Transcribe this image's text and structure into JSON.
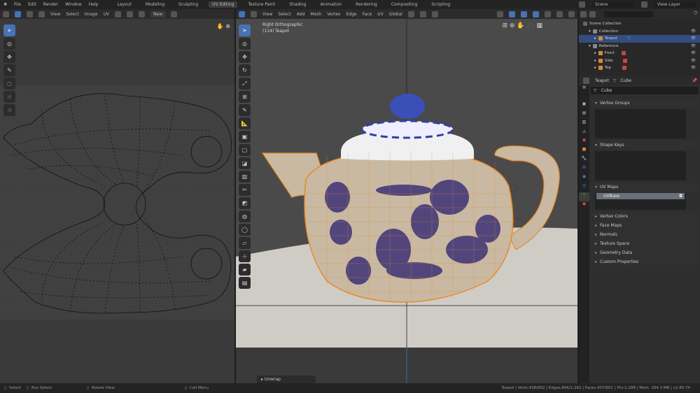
{
  "menu": [
    "File",
    "Edit",
    "Render",
    "Window",
    "Help"
  ],
  "workspaces": [
    "Layout",
    "Modeling",
    "Sculpting",
    "UV Editing",
    "Texture Paint",
    "Shading",
    "Animation",
    "Rendering",
    "Compositing",
    "Scripting"
  ],
  "active_workspace": "UV Editing",
  "scene": "Scene",
  "view_layer": "View Layer",
  "uv_header": {
    "menus": [
      "View",
      "Select",
      "Image",
      "UV"
    ],
    "new_label": "New"
  },
  "vp_header": {
    "menus": [
      "View",
      "Select",
      "Add",
      "Mesh",
      "Vertex",
      "Edge",
      "Face",
      "UV"
    ],
    "orientation": "Global"
  },
  "viewport": {
    "view_name": "Right Orthographic",
    "object_label": "(114) Teapot",
    "operator_panel": "Unwrap"
  },
  "outliner": {
    "search_placeholder": "",
    "rows": [
      {
        "label": "Scene Collection",
        "level": 0
      },
      {
        "label": "Collection",
        "level": 1
      },
      {
        "label": "Teapot",
        "level": 2,
        "selected": true
      },
      {
        "label": "Reference",
        "level": 1
      },
      {
        "label": "Front",
        "level": 2
      },
      {
        "label": "Side",
        "level": 2
      },
      {
        "label": "Top",
        "level": 2
      }
    ]
  },
  "properties": {
    "object": "Teapot",
    "data": "Cube",
    "mesh_name": "Cube",
    "panels": [
      "Vertex Groups",
      "Shape Keys",
      "UV Maps",
      "Vertex Colors",
      "Face Maps",
      "Normals",
      "Texture Space",
      "Geometry Data",
      "Custom Properties"
    ],
    "uv_map": "UVBase"
  },
  "status": {
    "select": "Select",
    "box_select": "Box Select",
    "rotate": "Rotate View",
    "call_menu": "Call Menu",
    "stats": "Teapot | Verts:438/662 | Edges:846/1,262 | Faces:407/601 | Tris:1,288 | Mem: 164.3 MB | v2.80.74"
  },
  "colors": {
    "accent": "#4772b3",
    "wire": "#e88a2a",
    "selected_row": "#334d80"
  }
}
